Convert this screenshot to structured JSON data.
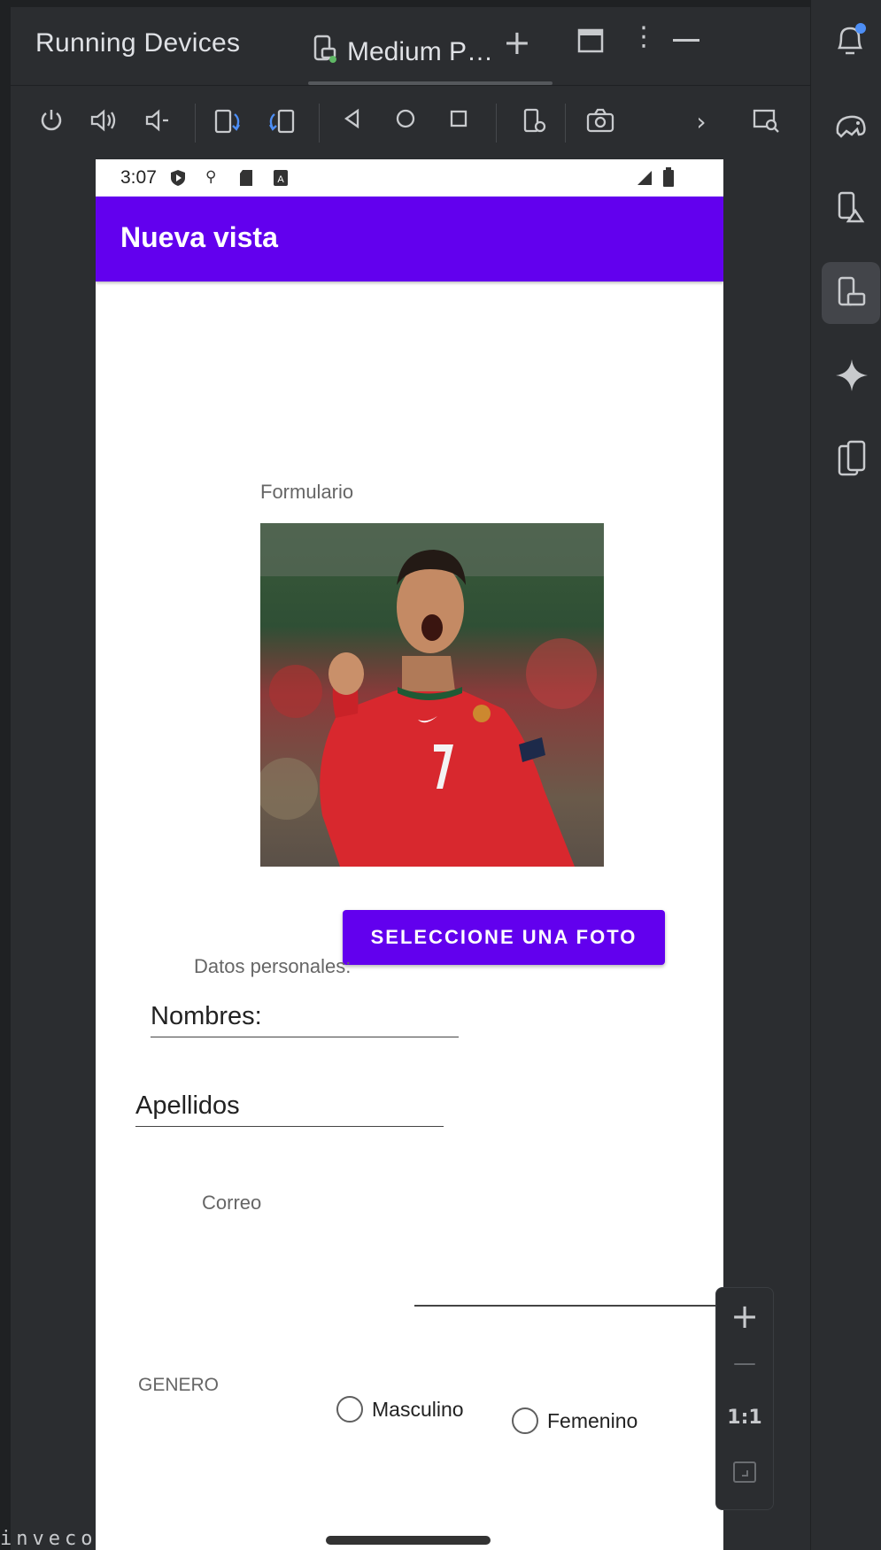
{
  "ide": {
    "panel_title": "Running Devices",
    "tab_label": "Medium P…",
    "icons": {
      "new_tab": "plus-icon",
      "window": "window-icon",
      "more": "more-vertical-icon",
      "minimize": "minimize-icon"
    },
    "toolbar": [
      "power-icon",
      "volume-up-icon",
      "volume-down-icon",
      "rotate-left-icon",
      "rotate-right-icon",
      "back-icon",
      "home-icon",
      "overview-icon",
      "device-settings-icon",
      "camera-icon",
      "chevron-right-icon",
      "device-mirror-icon"
    ],
    "right_strip": [
      "notifications-icon",
      "gradle-elephant-icon",
      "device-manager-icon",
      "running-devices-icon",
      "gemini-icon",
      "device-explorer-icon"
    ],
    "zoom": {
      "plus": "+",
      "minus": "—",
      "one_to_one": "1:1"
    },
    "bottom_text": "inveco"
  },
  "device": {
    "status_time": "3:07",
    "appbar_title": "Nueva vista",
    "form_label": "Formulario",
    "select_photo": "SELECCIONE UNA FOTO",
    "personal_data": "Datos personales:",
    "nombres": "Nombres:",
    "apellidos": "Apellidos",
    "correo_label": "Correo",
    "genero_label": "GENERO",
    "radio_masculino": "Masculino",
    "radio_femenino": "Femenino",
    "accent_color": "#6200ee"
  }
}
